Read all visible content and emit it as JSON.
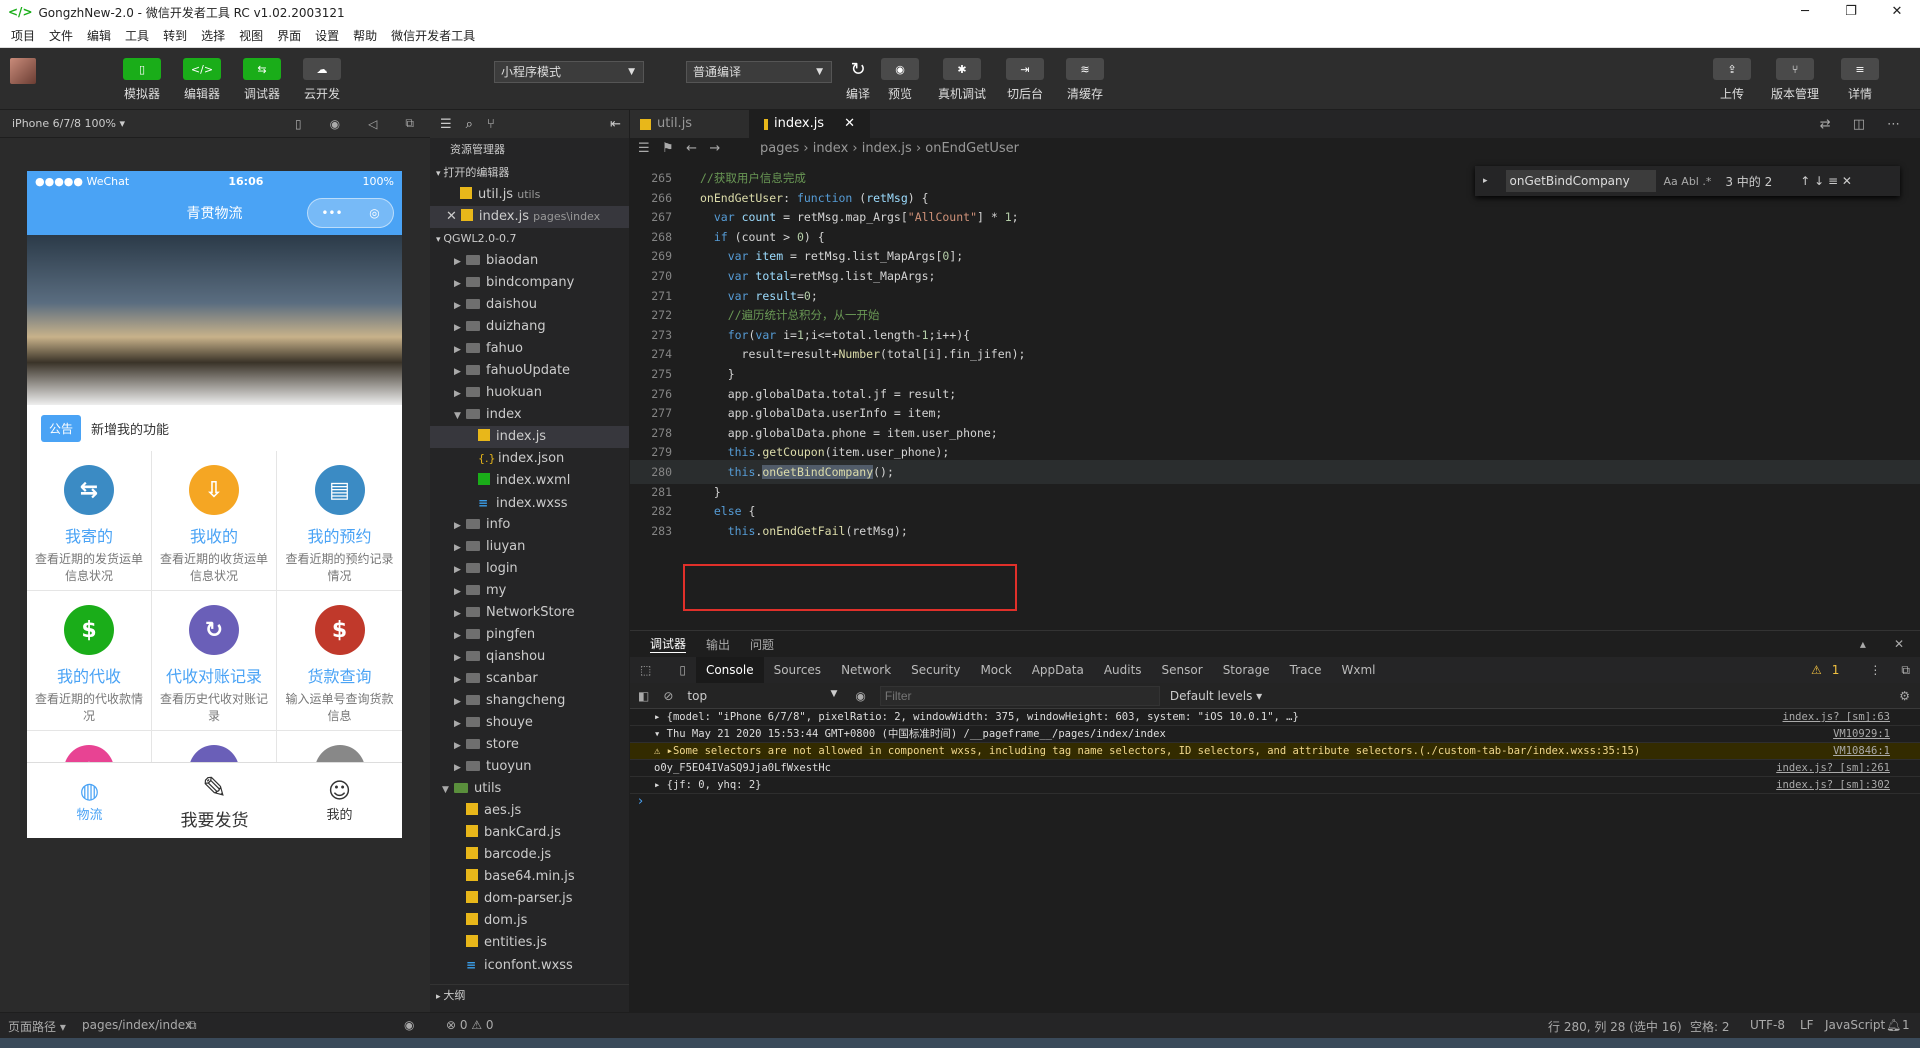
{
  "window": {
    "title": "GongzhNew-2.0 - 微信开发者工具 RC v1.02.2003121",
    "minimize": "─",
    "maximize": "❐",
    "close": "✕"
  },
  "menu": [
    "项目",
    "文件",
    "编辑",
    "工具",
    "转到",
    "选择",
    "视图",
    "界面",
    "设置",
    "帮助",
    "微信开发者工具"
  ],
  "toolbar": {
    "simulator": "模拟器",
    "editor": "编辑器",
    "debugger": "调试器",
    "cloud": "云开发",
    "mode_select": "小程序模式",
    "compile_select": "普通编译",
    "compile": "编译",
    "preview": "预览",
    "device_debug": "真机调试",
    "background": "切后台",
    "clear_cache": "清缓存",
    "upload": "上传",
    "version": "版本管理",
    "details": "详情"
  },
  "simulator": {
    "device": "iPhone 6/7/8 100% ▾",
    "status_left": "●●●●● WeChat",
    "status_time": "16:06",
    "status_right": "100%",
    "nav_title": "青贯物流",
    "notice_tag": "公告",
    "notice_text": "新增我的功能",
    "grid": [
      {
        "title": "我寄的",
        "desc": "查看近期的发货运单信息状况",
        "color": "#3b8bc4",
        "glyph": "⇆"
      },
      {
        "title": "我收的",
        "desc": "查看近期的收货运单信息状况",
        "color": "#f5a623",
        "glyph": "⇩"
      },
      {
        "title": "我的预约",
        "desc": "查看近期的预约记录情况",
        "color": "#3b8bc4",
        "glyph": "▤"
      },
      {
        "title": "我的代收",
        "desc": "查看近期的代收款情况",
        "color": "#1aad19",
        "glyph": "$"
      },
      {
        "title": "代收对账记录",
        "desc": "查看历史代收对账记录",
        "color": "#6a5fb8",
        "glyph": "↻"
      },
      {
        "title": "货款查询",
        "desc": "输入运单号查询货款信息",
        "color": "#c0392b",
        "glyph": "$"
      },
      {
        "title": "",
        "desc": "",
        "color": "#e84393",
        "glyph": "★"
      },
      {
        "title": "",
        "desc": "",
        "color": "#6a5fb8",
        "glyph": "▥"
      },
      {
        "title": "",
        "desc": "",
        "color": "#888888",
        "glyph": "▦"
      }
    ],
    "tabs": [
      "物流",
      "我要发货",
      "我的"
    ]
  },
  "explorer": {
    "title": "资源管理器",
    "open_editors": "打开的编辑器",
    "open_files": [
      {
        "name": "util.js",
        "path": "utils"
      },
      {
        "name": "index.js",
        "path": "pages\\index"
      }
    ],
    "project": "QGWL2.0-0.7",
    "tree": [
      {
        "d": 1,
        "t": "folder",
        "n": "biaodan"
      },
      {
        "d": 1,
        "t": "folder",
        "n": "bindcompany"
      },
      {
        "d": 1,
        "t": "folder",
        "n": "daishou"
      },
      {
        "d": 1,
        "t": "folder",
        "n": "duizhang"
      },
      {
        "d": 1,
        "t": "folder",
        "n": "fahuo"
      },
      {
        "d": 1,
        "t": "folder",
        "n": "fahuoUpdate"
      },
      {
        "d": 1,
        "t": "folder",
        "n": "huokuan"
      },
      {
        "d": 1,
        "t": "open",
        "n": "index"
      },
      {
        "d": 2,
        "t": "js",
        "n": "index.js"
      },
      {
        "d": 2,
        "t": "json",
        "n": "index.json"
      },
      {
        "d": 2,
        "t": "wxml",
        "n": "index.wxml"
      },
      {
        "d": 2,
        "t": "css",
        "n": "index.wxss"
      },
      {
        "d": 1,
        "t": "folder",
        "n": "info"
      },
      {
        "d": 1,
        "t": "folder",
        "n": "liuyan"
      },
      {
        "d": 1,
        "t": "folder",
        "n": "login"
      },
      {
        "d": 1,
        "t": "folder",
        "n": "my"
      },
      {
        "d": 1,
        "t": "folder",
        "n": "NetworkStore"
      },
      {
        "d": 1,
        "t": "folder",
        "n": "pingfen"
      },
      {
        "d": 1,
        "t": "folder",
        "n": "qianshou"
      },
      {
        "d": 1,
        "t": "folder",
        "n": "scanbar"
      },
      {
        "d": 1,
        "t": "folder",
        "n": "shangcheng"
      },
      {
        "d": 1,
        "t": "folder",
        "n": "shouye"
      },
      {
        "d": 1,
        "t": "folder",
        "n": "store"
      },
      {
        "d": 1,
        "t": "folder",
        "n": "tuoyun"
      },
      {
        "d": 0,
        "t": "open",
        "n": "utils"
      },
      {
        "d": 1,
        "t": "js",
        "n": "aes.js"
      },
      {
        "d": 1,
        "t": "js",
        "n": "bankCard.js"
      },
      {
        "d": 1,
        "t": "js",
        "n": "barcode.js"
      },
      {
        "d": 1,
        "t": "js",
        "n": "base64.min.js"
      },
      {
        "d": 1,
        "t": "js",
        "n": "dom-parser.js"
      },
      {
        "d": 1,
        "t": "js",
        "n": "dom.js"
      },
      {
        "d": 1,
        "t": "js",
        "n": "entities.js"
      },
      {
        "d": 1,
        "t": "css",
        "n": "iconfont.wxss"
      }
    ],
    "outline": "大纲"
  },
  "editor": {
    "tabs": [
      "util.js",
      "index.js"
    ],
    "breadcrumb": "pages  ›  index  ›  index.js  ›  onEndGetUser",
    "find_query": "onGetBindCompany",
    "find_opts": "Aa  Abl  .*",
    "find_result": "3 中的 2",
    "find_nav": "↑  ↓  ≡   ✕",
    "lines": [
      {
        "no": "265",
        "html": "<span class='c'>//获取用户信息完成</span>"
      },
      {
        "no": "266",
        "html": "<span class='f'>onEndGetUser</span><span class='pl'>: </span><span class='k'>function</span><span class='pl'> (</span><span class='p'>retMsg</span><span class='pl'>) {</span>"
      },
      {
        "no": "267",
        "html": "  <span class='k'>var</span> <span class='p'>count</span><span class='pl'> = retMsg.map_Args[</span><span class='s'>\"AllCount\"</span><span class='pl'>] * </span><span class='n'>1</span><span class='pl'>;</span>"
      },
      {
        "no": "268",
        "html": "  <span class='k'>if</span><span class='pl'> (count &gt; </span><span class='n'>0</span><span class='pl'>) {</span>"
      },
      {
        "no": "269",
        "html": "    <span class='k'>var</span> <span class='p'>item</span><span class='pl'> = retMsg.list_MapArgs[</span><span class='n'>0</span><span class='pl'>];</span>"
      },
      {
        "no": "270",
        "html": "    <span class='k'>var</span> <span class='p'>total</span><span class='pl'>=retMsg.list_MapArgs;</span>"
      },
      {
        "no": "271",
        "html": "    <span class='k'>var</span> <span class='p'>result</span><span class='pl'>=</span><span class='n'>0</span><span class='pl'>;</span>"
      },
      {
        "no": "272",
        "html": "    <span class='c'>//遍历统计总积分，从一开始</span>"
      },
      {
        "no": "273",
        "html": "    <span class='k'>for</span><span class='pl'>(</span><span class='k'>var</span><span class='pl'> i=</span><span class='n'>1</span><span class='pl'>;i&lt;=total.length-</span><span class='n'>1</span><span class='pl'>;i++){</span>"
      },
      {
        "no": "274",
        "html": "      <span class='pl'>result=result+</span><span class='f'>Number</span><span class='pl'>(total[i].fin_jifen);</span>"
      },
      {
        "no": "275",
        "html": "    <span class='pl'>}</span>"
      },
      {
        "no": "276",
        "html": "    <span class='pl'>app.globalData.total.jf = result;</span>"
      },
      {
        "no": "277",
        "html": "    <span class='pl'>app.globalData.userInfo = item;</span>"
      },
      {
        "no": "278",
        "html": "    <span class='pl'>app.globalData.phone = item.user_phone;</span>"
      },
      {
        "no": "279",
        "html": "    <span class='k'>this</span><span class='pl'>.</span><span class='f'>getCoupon</span><span class='pl'>(item.user_phone);</span>"
      },
      {
        "no": "280",
        "html": "    <span class='k'>this</span><span class='pl'>.</span><span class='f' style='background:#515c6a'>onGetBindCompany</span><span class='pl'>();</span>"
      },
      {
        "no": "281",
        "html": "  <span class='pl'>}</span>"
      },
      {
        "no": "282",
        "html": "  <span class='k'>else</span><span class='pl'> {</span>"
      },
      {
        "no": "283",
        "html": "    <span class='k'>this</span><span class='pl'>.</span><span class='f'>onEndGetFail</span><span class='pl'>(retMsg);</span>"
      }
    ]
  },
  "panel": {
    "tabs": [
      "调试器",
      "输出",
      "问题"
    ],
    "devtabs": [
      "Console",
      "Sources",
      "Network",
      "Security",
      "Mock",
      "AppData",
      "Audits",
      "Sensor",
      "Storage",
      "Trace",
      "Wxml"
    ],
    "warn_count": "1",
    "context": "top",
    "filter_placeholder": "Filter",
    "levels": "Default levels ▾",
    "rows": [
      {
        "text": "▸ {model: \"iPhone 6/7/8\", pixelRatio: 2, windowWidth: 375, windowHeight: 603, system: \"iOS 10.0.1\", …}",
        "src": "index.js? [sm]:63",
        "warn": false
      },
      {
        "text": "▾ Thu May 21 2020 15:53:44 GMT+0800 (中国标准时间) /__pageframe__/pages/index/index",
        "src": "VM10929:1",
        "warn": false
      },
      {
        "text": "⚠ ▸Some selectors are not allowed in component wxss, including tag name selectors, ID selectors, and attribute selectors.(./custom-tab-bar/index.wxss:35:15)",
        "src": "VM10846:1",
        "warn": true
      },
      {
        "text": "o0y_F5EO4IVaSQ9Jja0LfWxestHc",
        "src": "index.js? [sm]:261",
        "warn": false
      },
      {
        "text": "▸ {jf: 0, yhq: 2}",
        "src": "index.js? [sm]:302",
        "warn": false
      }
    ],
    "prompt": "›"
  },
  "status": {
    "page_path_label": "页面路径 ▾",
    "page_path": "pages/index/index",
    "problems": "⊗ 0 ⚠ 0",
    "cursor": "行 280, 列 28 (选中 16)",
    "spaces": "空格: 2",
    "encoding": "UTF-8",
    "eol": "LF",
    "language": "JavaScript",
    "notifications": "1"
  }
}
